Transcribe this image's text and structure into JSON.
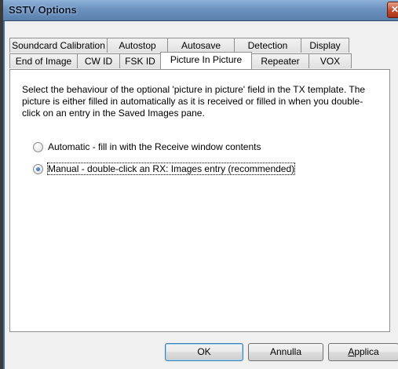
{
  "window": {
    "title": "SSTV Options",
    "close_glyph": "✕"
  },
  "tabs": {
    "back_row": [
      {
        "label": "Soundcard Calibration"
      },
      {
        "label": "Autostop"
      },
      {
        "label": "Autosave"
      },
      {
        "label": "Detection"
      },
      {
        "label": "Display"
      }
    ],
    "front_row": [
      {
        "label": "End of Image"
      },
      {
        "label": "CW ID"
      },
      {
        "label": "FSK ID"
      },
      {
        "label": "Picture In Picture",
        "active": true
      },
      {
        "label": "Repeater"
      },
      {
        "label": "VOX"
      }
    ]
  },
  "panel": {
    "description": "Select the behaviour of the optional 'picture in picture' field in the TX template. The picture is either filled in automatically as it is received or filled in when you double-click on an entry in the Saved Images pane.",
    "options": [
      {
        "label": "Automatic - fill in with the Receive window contents",
        "checked": false
      },
      {
        "label": "Manual - double-click an RX: Images entry (recommended)",
        "checked": true
      }
    ]
  },
  "buttons": {
    "ok": "OK",
    "annulla": "Annulla",
    "applica_first": "A",
    "applica_rest": "pplica"
  }
}
